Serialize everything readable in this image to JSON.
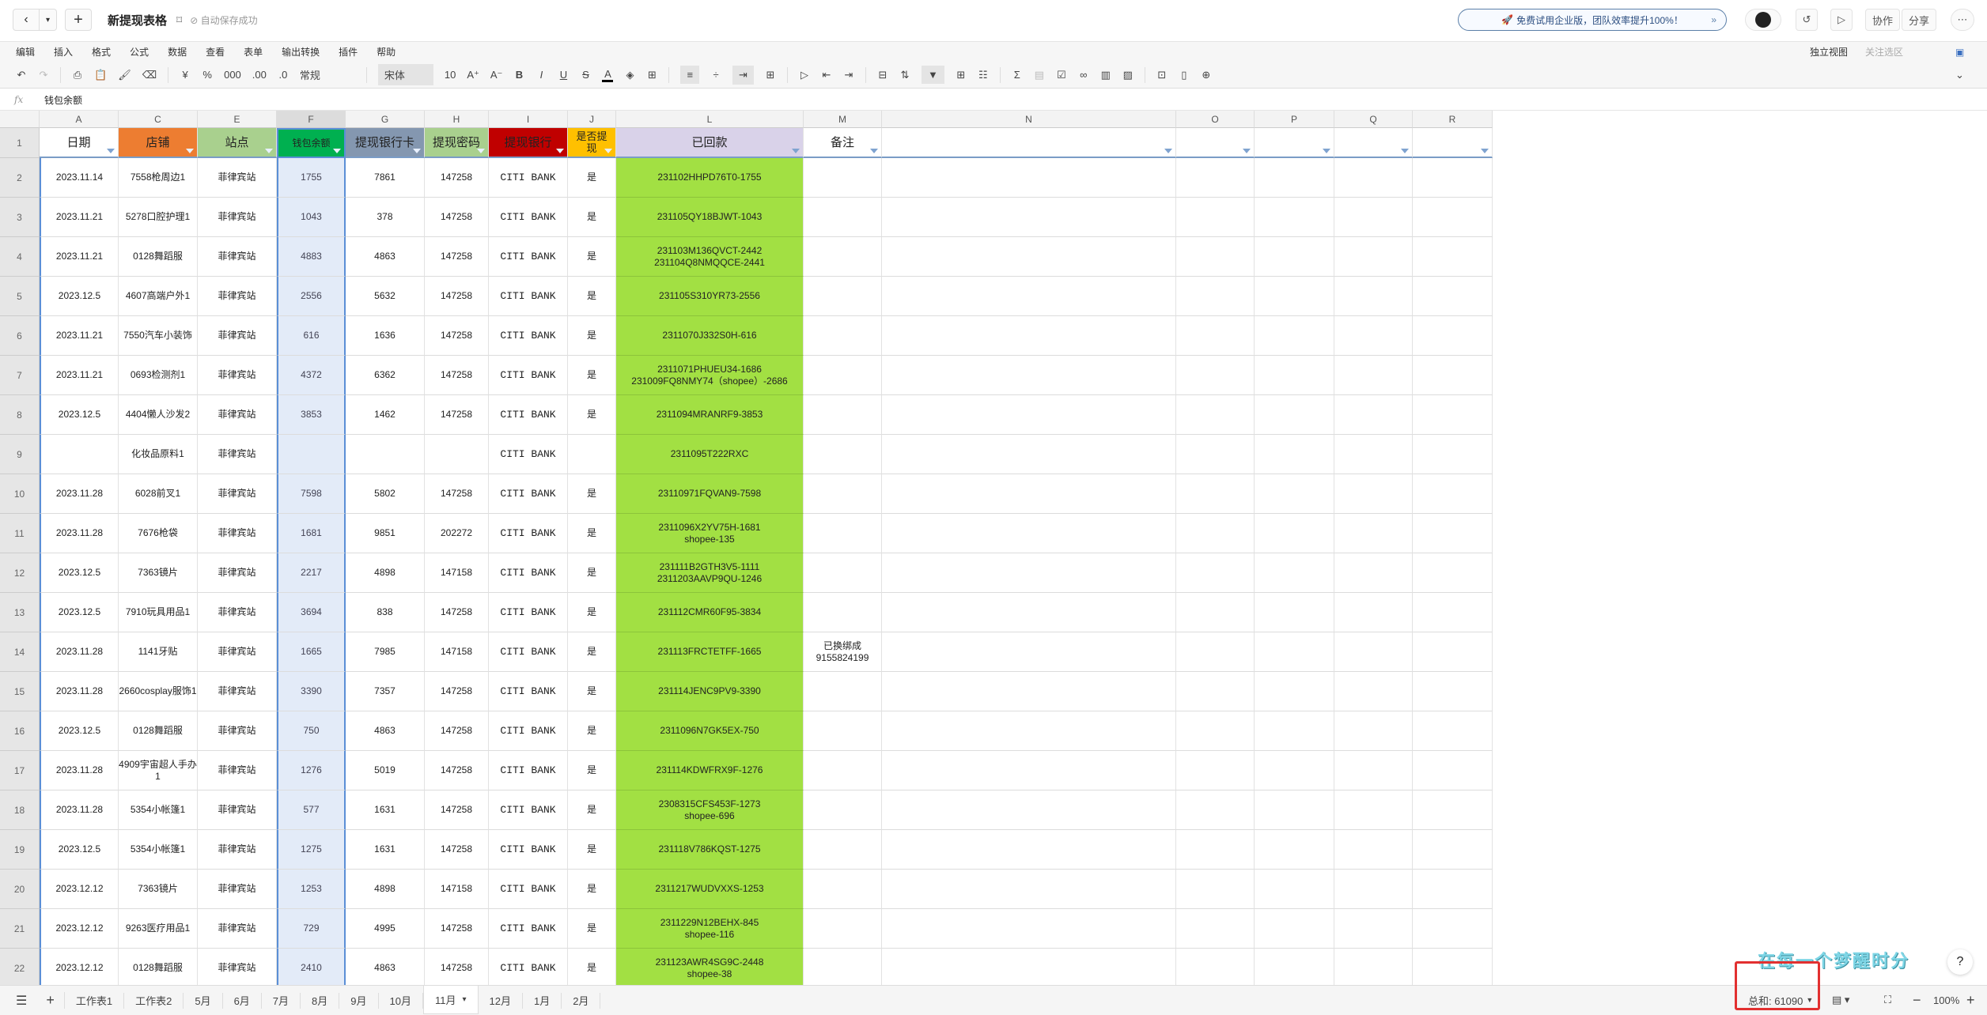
{
  "header": {
    "back_icon": "chevron-left",
    "dropdown_icon": "caret-down",
    "new_icon": "plus",
    "title": "新提现表格",
    "save_status": "自动保存成功",
    "promo": "免费试用企业版，团队效率提升100%！",
    "collab": "协作",
    "share": "分享"
  },
  "menu": [
    "编辑",
    "插入",
    "格式",
    "公式",
    "数据",
    "查看",
    "表单",
    "输出转换",
    "插件",
    "帮助"
  ],
  "menu_right": {
    "view": "独立视图",
    "focus": "关注选区"
  },
  "toolbar": {
    "currency": "¥",
    "percent": "%",
    "thousands": "000",
    "dec_inc": ".00",
    "dec_dec": ".0",
    "format": "常规",
    "font": "宋体",
    "size": "10",
    "bold": "B",
    "italic": "I",
    "underline": "U",
    "strike": "S",
    "color": "A"
  },
  "formula": {
    "fx": "fx",
    "value": "钱包余额"
  },
  "columns": [
    "A",
    "C",
    "E",
    "F",
    "G",
    "H",
    "I",
    "J",
    "L",
    "M",
    "N",
    "O",
    "P",
    "Q",
    "R"
  ],
  "header_row": [
    "日期",
    "店铺",
    "站点",
    "钱包余额",
    "提现银行卡",
    "提现密码",
    "提现银行",
    "是否提现",
    "已回款",
    "备注",
    "",
    "",
    "",
    "",
    ""
  ],
  "colors": {
    "C": "#ED7D31",
    "E": "#A9D08E",
    "F": "#00B050",
    "G": "#8497B0",
    "H": "#A9D08E",
    "I": "#C00000",
    "J": "#FFC000",
    "L": "#D9D2E9",
    "L_data": "#A2E043",
    "F_data": "#E3EBF8",
    "selection": "#5B8FD6"
  },
  "rows": [
    [
      "2",
      "2023.11.14",
      "7558枪周边1",
      "菲律宾站",
      "1755",
      "7861",
      "147258",
      "CITI BANK",
      "是",
      "231102HHPD76T0-1755",
      ""
    ],
    [
      "3",
      "2023.11.21",
      "5278口腔护理1",
      "菲律宾站",
      "1043",
      "378",
      "147258",
      "CITI BANK",
      "是",
      "231105QY18BJWT-1043",
      ""
    ],
    [
      "4",
      "2023.11.21",
      "0128舞蹈服",
      "菲律宾站",
      "4883",
      "4863",
      "147258",
      "CITI BANK",
      "是",
      "231103M136QVCT-2442\n231104Q8NMQQCE-2441",
      ""
    ],
    [
      "5",
      "2023.12.5",
      "4607高端户外1",
      "菲律宾站",
      "2556",
      "5632",
      "147258",
      "CITI BANK",
      "是",
      "231105S310YR73-2556",
      ""
    ],
    [
      "6",
      "2023.11.21",
      "7550汽车小装饰",
      "菲律宾站",
      "616",
      "1636",
      "147258",
      "CITI BANK",
      "是",
      "2311070J332S0H-616",
      ""
    ],
    [
      "7",
      "2023.11.21",
      "0693检测剂1",
      "菲律宾站",
      "4372",
      "6362",
      "147258",
      "CITI BANK",
      "是",
      "2311071PHUEU34-1686\n231009FQ8NMY74（shopee）-2686",
      ""
    ],
    [
      "8",
      "2023.12.5",
      "4404懒人沙发2",
      "菲律宾站",
      "3853",
      "1462",
      "147258",
      "CITI BANK",
      "是",
      "2311094MRANRF9-3853",
      ""
    ],
    [
      "9",
      "",
      "化妆品原料1",
      "菲律宾站",
      "",
      "",
      "",
      "CITI BANK",
      "",
      "2311095T222RXC",
      ""
    ],
    [
      "10",
      "2023.11.28",
      "6028前叉1",
      "菲律宾站",
      "7598",
      "5802",
      "147258",
      "CITI BANK",
      "是",
      "23110971FQVAN9-7598",
      ""
    ],
    [
      "11",
      "2023.11.28",
      "7676枪袋",
      "菲律宾站",
      "1681",
      "9851",
      "202272",
      "CITI BANK",
      "是",
      "2311096X2YV75H-1681\nshopee-135",
      ""
    ],
    [
      "12",
      "2023.12.5",
      "7363镜片",
      "菲律宾站",
      "2217",
      "4898",
      "147158",
      "CITI BANK",
      "是",
      "231111B2GTH3V5-1111\n2311203AAVP9QU-1246",
      ""
    ],
    [
      "13",
      "2023.12.5",
      "7910玩具用品1",
      "菲律宾站",
      "3694",
      "838",
      "147258",
      "CITI BANK",
      "是",
      "231112CMR60F95-3834",
      ""
    ],
    [
      "14",
      "2023.11.28",
      "1141牙贴",
      "菲律宾站",
      "1665",
      "7985",
      "147158",
      "CITI BANK",
      "是",
      "231113FRCTETFF-1665",
      "已换绑成\n9155824199"
    ],
    [
      "15",
      "2023.11.28",
      "2660cosplay服饰1",
      "菲律宾站",
      "3390",
      "7357",
      "147258",
      "CITI BANK",
      "是",
      "231114JENC9PV9-3390",
      ""
    ],
    [
      "16",
      "2023.12.5",
      "0128舞蹈服",
      "菲律宾站",
      "750",
      "4863",
      "147258",
      "CITI BANK",
      "是",
      "2311096N7GK5EX-750",
      ""
    ],
    [
      "17",
      "2023.11.28",
      "4909宇宙超人手办1",
      "菲律宾站",
      "1276",
      "5019",
      "147258",
      "CITI BANK",
      "是",
      "231114KDWFRX9F-1276",
      ""
    ],
    [
      "18",
      "2023.11.28",
      "5354小帐篷1",
      "菲律宾站",
      "577",
      "1631",
      "147258",
      "CITI BANK",
      "是",
      "2308315CFS453F-1273\nshopee-696",
      ""
    ],
    [
      "19",
      "2023.12.5",
      "5354小帐篷1",
      "菲律宾站",
      "1275",
      "1631",
      "147258",
      "CITI BANK",
      "是",
      "231118V786KQST-1275",
      ""
    ],
    [
      "20",
      "2023.12.12",
      "7363镜片",
      "菲律宾站",
      "1253",
      "4898",
      "147158",
      "CITI BANK",
      "是",
      "2311217WUDVXXS-1253",
      ""
    ],
    [
      "21",
      "2023.12.12",
      "9263医疗用品1",
      "菲律宾站",
      "729",
      "4995",
      "147258",
      "CITI BANK",
      "是",
      "2311229N12BEHX-845\nshopee-116",
      ""
    ],
    [
      "22",
      "2023.12.12",
      "0128舞蹈服",
      "菲律宾站",
      "2410",
      "4863",
      "147258",
      "CITI BANK",
      "是",
      "231123AWR4SG9C-2448\nshopee-38",
      ""
    ]
  ],
  "sheets": [
    "工作表1",
    "工作表2",
    "5月",
    "6月",
    "7月",
    "8月",
    "9月",
    "10月",
    "11月",
    "12月",
    "1月",
    "2月"
  ],
  "active_sheet": "11月",
  "status": {
    "sum": "总和: 61090",
    "zoom": "100%",
    "help": "?"
  },
  "watermark": "在每一个梦醒时分"
}
